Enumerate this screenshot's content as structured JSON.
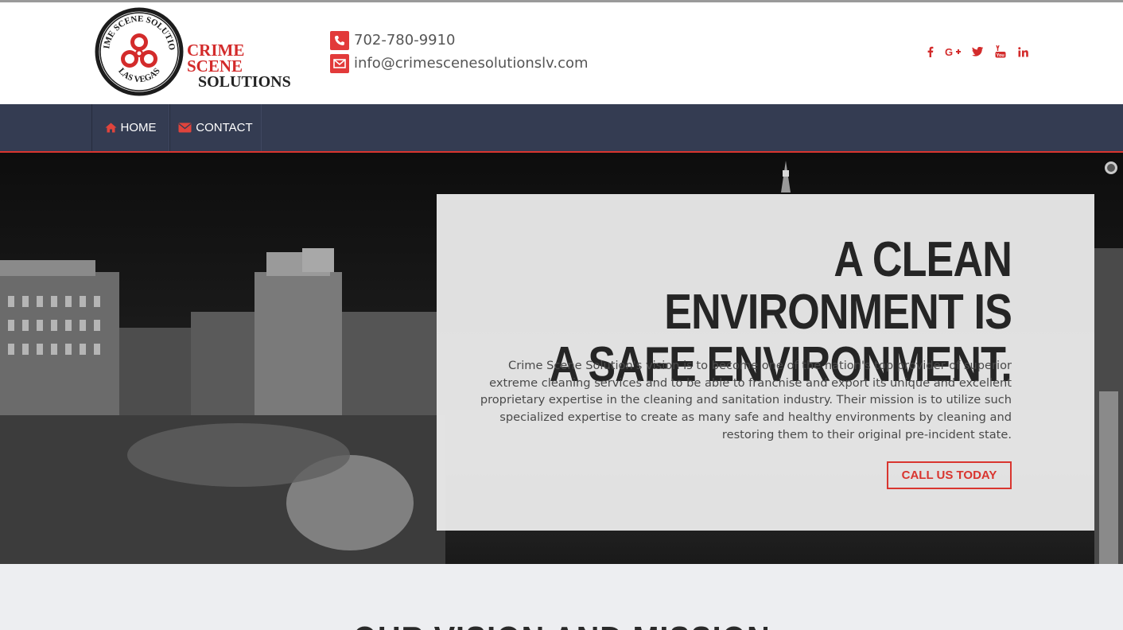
{
  "header": {
    "logo": {
      "ring_text_top": "CRIME SCENE SOLUTIONS",
      "ring_text_bottom": "LAS VEGAS",
      "wordmark_line1": "CRIME SCENE",
      "wordmark_line2": "SOLUTIONS"
    },
    "contact": {
      "phone_icon": "phone-icon",
      "phone": "702-780-9910",
      "email_icon": "envelope-icon",
      "email": "info@crimescenesolutionslv.com"
    },
    "social": [
      {
        "icon": "facebook-icon",
        "glyph": "f"
      },
      {
        "icon": "google-plus-icon",
        "glyph": "G+"
      },
      {
        "icon": "twitter-icon",
        "glyph": "t"
      },
      {
        "icon": "youtube-icon",
        "glyph": "You"
      },
      {
        "icon": "linkedin-icon",
        "glyph": "in"
      }
    ]
  },
  "nav": {
    "items": [
      {
        "label": "HOME",
        "icon": "home-icon"
      },
      {
        "label": "CONTACT",
        "icon": "envelope-icon"
      }
    ]
  },
  "hero": {
    "title_line1": "A CLEAN ENVIRONMENT IS",
    "title_line2": "A SAFE ENVIRONMENT.",
    "body": "Crime Scene Solution's vision is to become one of the nation's top provider of superior extreme cleaning services and to be able to franchise and export its unique and excellent proprietary expertise in the cleaning and sanitation industry. Their mission is to utilize such specialized expertise to create as many safe and healthy environments by cleaning and restoring them to their original pre-incident state.",
    "cta_label": "CALL US TODAY"
  },
  "section": {
    "title": "OUR VISION AND MISSION"
  },
  "colors": {
    "accent": "#d9352f",
    "nav_bg": "#343c52",
    "text_dark": "#252525"
  }
}
